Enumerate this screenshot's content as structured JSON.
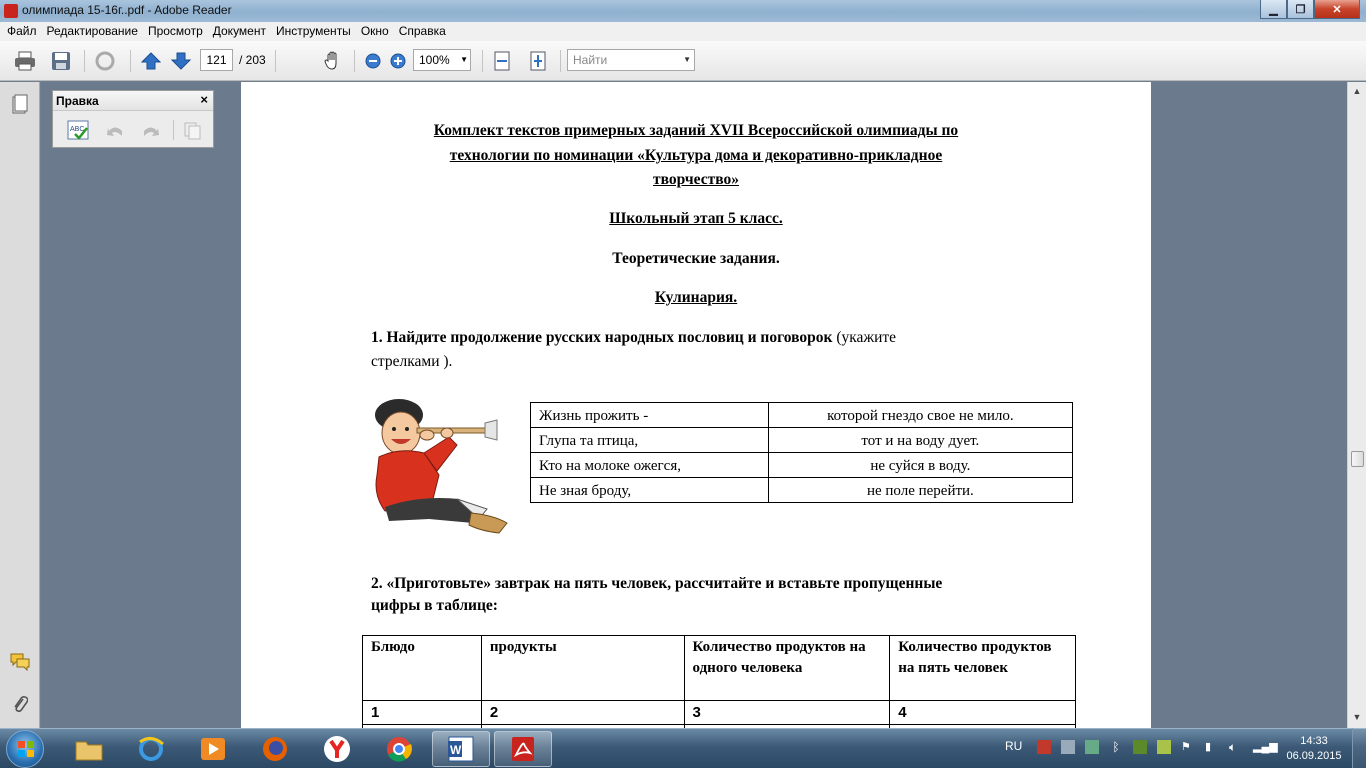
{
  "window": {
    "title": "олимпиада 15-16г..pdf - Adobe Reader"
  },
  "menu": [
    "Файл",
    "Редактирование",
    "Просмотр",
    "Документ",
    "Инструменты",
    "Окно",
    "Справка"
  ],
  "toolbar": {
    "page_current": "121",
    "page_total": "/ 203",
    "zoom": "100%",
    "find_placeholder": "Найти"
  },
  "edit_panel": {
    "title": "Правка",
    "close": "×"
  },
  "document": {
    "heading_lines": [
      "Комплект текстов примерных заданий XVII Всероссийской олимпиады по",
      "технологии по номинации «Культура дома и декоративно-прикладное",
      "творчество»"
    ],
    "stage": "Школьный  этап 5 класс.",
    "section": "Теоретические задания.",
    "subsection": "Кулинария.",
    "task1_bold": "1. Найдите продолжение русских народных пословиц и поговорок",
    "task1_normal": " (укажите",
    "task1_line2": "стрелками ).",
    "proverbs": [
      [
        "Жизнь прожить -",
        "которой гнездо свое не мило."
      ],
      [
        "Глупа та птица,",
        "тот и на воду дует."
      ],
      [
        "Кто на молоке ожегся,",
        "не суйся в воду."
      ],
      [
        "Не зная броду,",
        "не поле перейти."
      ]
    ],
    "task2_line1": "2. «Приготовьте»  завтрак на пять человек, рассчитайте и вставьте пропущенные",
    "task2_line2": "цифры в таблице:",
    "table_headers": [
      "Блюдо",
      "продукты",
      "Количество продуктов на одного человека",
      "Количество продуктов на пять человек"
    ],
    "table_numbers": [
      "1",
      "2",
      "3",
      "4"
    ]
  },
  "tray": {
    "lang": "RU",
    "time": "14:33",
    "date": "06.09.2015"
  },
  "colors": {
    "titlebar": "#9dbad6",
    "docbg": "#6b7b8d",
    "taskbar": "#3c5a77"
  }
}
